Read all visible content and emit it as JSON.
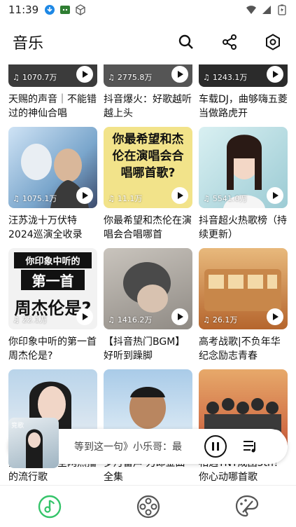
{
  "status": {
    "time": "11:39",
    "left_icons": [
      "download-icon",
      "android-notification-icon",
      "cube-icon"
    ],
    "right_icons": [
      "wifi-icon",
      "signal-icon",
      "battery-icon"
    ]
  },
  "header": {
    "title": "音乐",
    "actions": [
      "search-icon",
      "share-icon",
      "settings-icon"
    ]
  },
  "top_row": [
    {
      "title": "天赐的声音｜不能错过的神仙合唱",
      "count": "1070.7万"
    },
    {
      "title": "抖音爆火：好歌越听越上头",
      "count": "2775.8万"
    },
    {
      "title": "车载DJ，曲够嗨五菱当做路虎开",
      "count": "1243.1万"
    }
  ],
  "cards": [
    {
      "title": "汪苏泷十万伏特2024巡演全收录",
      "count": "1075.1万",
      "art": "blue"
    },
    {
      "title": "你最希望和杰伦在演唱会合唱哪首",
      "count": "11.1万",
      "art": "text1"
    },
    {
      "title": "抖音超火热歌榜（持续更新）",
      "count": "5541.0万",
      "art": "girl"
    },
    {
      "title": "你印象中听的第一首周杰伦是?",
      "count": "22.1万",
      "art": "text2"
    },
    {
      "title": "【抖音热门BGM】好听到躁脚",
      "count": "1416.2万",
      "art": "grey"
    },
    {
      "title": "高考战歌|不负年华纪念励志青春",
      "count": "26.1万",
      "art": "bus"
    },
    {
      "title": "抖音最火：全网热播的流行歌",
      "count": "",
      "art": "girl2"
    },
    {
      "title": "岁月留声·刀郎金曲全集",
      "count": "",
      "art": "man"
    },
    {
      "title": "相遇TNT成团5th！你心动哪首歌",
      "count": "",
      "art": "group"
    }
  ],
  "art_text": {
    "text1": "你最希望和杰伦在演唱会合唱哪首歌?",
    "text2_line1": "你印象中听的",
    "text2_line2": "第一首",
    "text2_line3": "周杰伦是?"
  },
  "mini_player": {
    "text": "等到这一句》小乐哥：最",
    "cover_label": "竞歌"
  },
  "bottom_nav": [
    {
      "name": "music",
      "icon": "music-note-icon",
      "active": true
    },
    {
      "name": "video",
      "icon": "film-reel-icon",
      "active": false
    },
    {
      "name": "art",
      "icon": "palette-icon",
      "active": false
    }
  ],
  "colors": {
    "accent": "#35c46a"
  }
}
